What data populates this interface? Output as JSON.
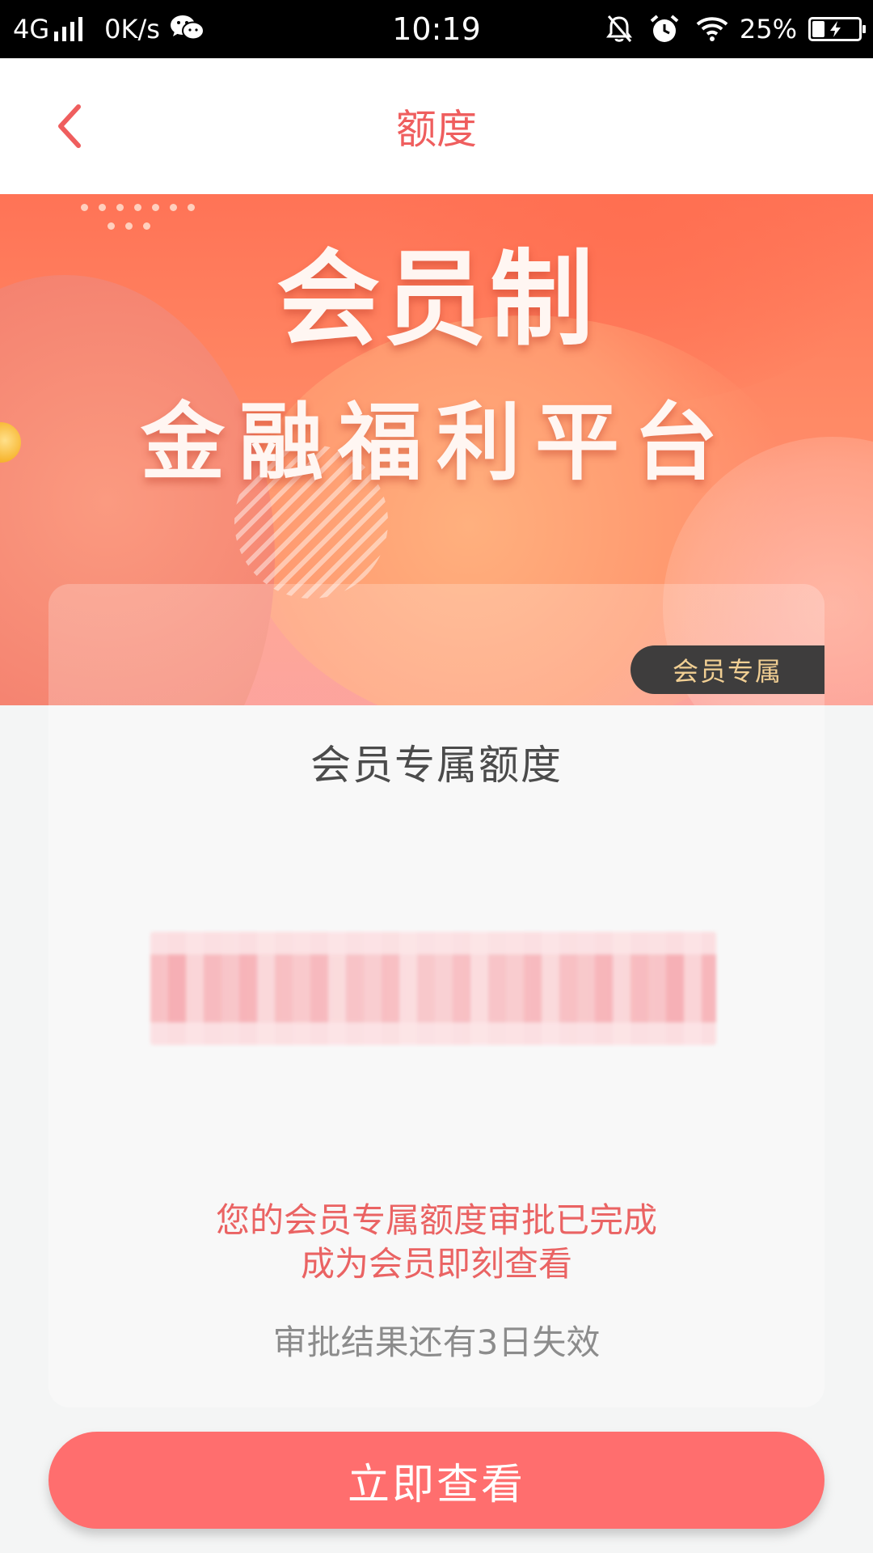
{
  "status_bar": {
    "network": "4G",
    "speed": "0K/s",
    "time": "10:19",
    "battery_text": "25%",
    "battery_level": 0.25,
    "icons": [
      "signal-icon",
      "wechat-icon",
      "mute-bell-icon",
      "alarm-icon",
      "wifi-icon",
      "battery-icon"
    ]
  },
  "nav": {
    "title": "额度",
    "back_icon": "chevron-left-icon"
  },
  "banner": {
    "title": "会员制",
    "subtitle": "金融福利平台"
  },
  "card": {
    "badge": "会员专属",
    "title": "会员专属额度",
    "approval_message": "您的会员专属额度审批已完成成为会员即刻查看",
    "expire_note": "审批结果还有3日失效"
  },
  "cta": {
    "label": "立即查看"
  },
  "colors": {
    "accent": "#ef5e5e",
    "button": "#ff6e6e",
    "badge_bg": "#3e3d3d",
    "badge_text": "#f1cf93"
  }
}
